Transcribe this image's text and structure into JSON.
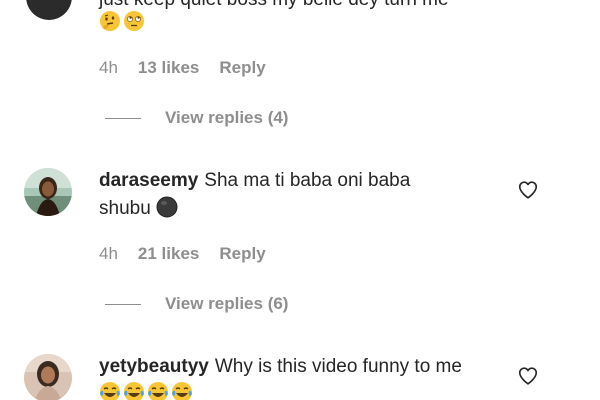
{
  "comments": [
    {
      "text_cut": "just keep quiet boss my belle dey turn me",
      "emojis": [
        "thinking-face",
        "face-with-rolling-eyes"
      ],
      "time": "4h",
      "likes": "13 likes",
      "reply": "Reply",
      "view_replies": "View replies (4)"
    },
    {
      "username": "daraseemy",
      "text_line1": "Sha ma ti baba oni baba",
      "text_line2": "shubu",
      "emojis": [
        "black-circle-face"
      ],
      "time": "4h",
      "likes": "21 likes",
      "reply": "Reply",
      "view_replies": "View replies (6)"
    },
    {
      "username": "yetybeautyy",
      "text_line1": "Why is this video funny to me",
      "emojis": [
        "tears-of-joy",
        "tears-of-joy",
        "tears-of-joy",
        "tears-of-joy"
      ]
    }
  ],
  "icons": {
    "like": "heart-outline-icon"
  },
  "colors": {
    "text": "#262626",
    "secondary": "#8e8e8e",
    "background": "#ffffff"
  }
}
